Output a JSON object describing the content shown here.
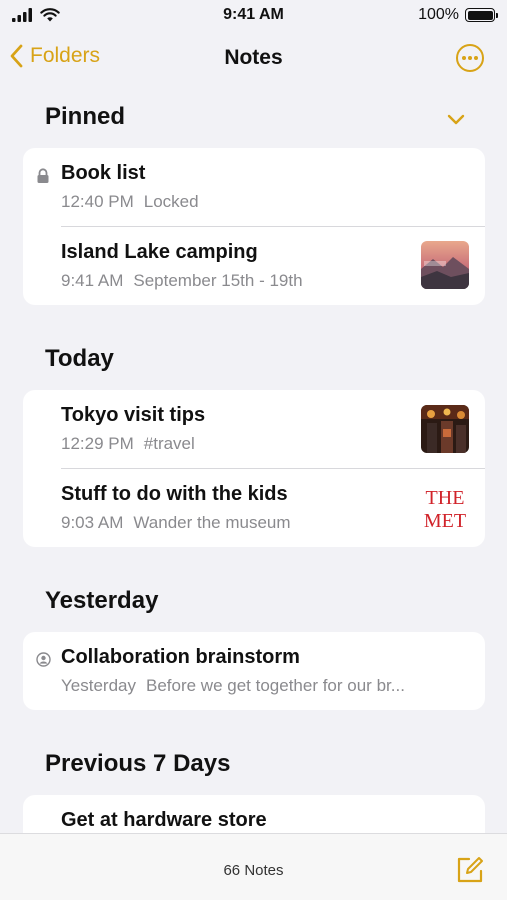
{
  "status": {
    "time": "9:41 AM",
    "battery": "100%"
  },
  "nav": {
    "back_label": "Folders",
    "title": "Notes"
  },
  "sections": {
    "pinned": "Pinned",
    "today": "Today",
    "yesterday": "Yesterday",
    "previous": "Previous 7 Days"
  },
  "notes": {
    "book_list": {
      "title": "Book list",
      "time": "12:40 PM",
      "preview": "Locked"
    },
    "island_lake": {
      "title": "Island Lake camping",
      "time": "9:41 AM",
      "preview": "September 15th - 19th"
    },
    "tokyo": {
      "title": "Tokyo visit tips",
      "time": "12:29 PM",
      "preview": "#travel"
    },
    "kids": {
      "title": "Stuff to do with the kids",
      "time": "9:03 AM",
      "preview": "Wander the museum",
      "thumb_text_1": "THE",
      "thumb_text_2": "MET"
    },
    "collab": {
      "title": "Collaboration brainstorm",
      "time": "Yesterday",
      "preview": "Before we get together for our br..."
    },
    "hardware": {
      "title": "Get at hardware store"
    }
  },
  "toolbar": {
    "count": "66 Notes"
  },
  "colors": {
    "accent": "#d8a317",
    "background": "#f2f2f6",
    "card": "#ffffff",
    "secondary_text": "#8a8a8e"
  }
}
